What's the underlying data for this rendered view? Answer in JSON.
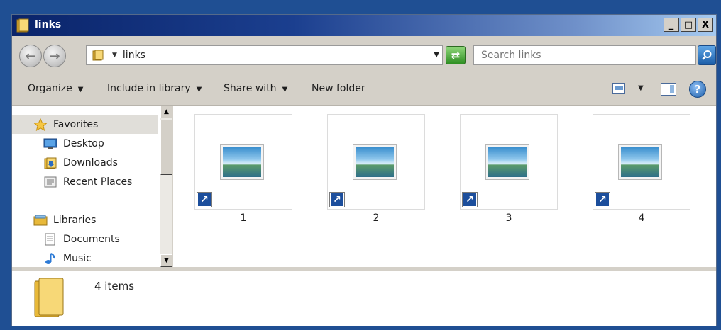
{
  "window": {
    "title": "links",
    "controls": {
      "minimize": "_",
      "maximize": "□",
      "close": "X"
    }
  },
  "address_bar": {
    "path": "links",
    "search_placeholder": "Search links"
  },
  "command_bar": {
    "organize": "Organize",
    "include_in_library": "Include in library",
    "share_with": "Share with",
    "new_folder": "New folder"
  },
  "nav_pane": {
    "favorites": {
      "label": "Favorites",
      "items": [
        {
          "label": "Desktop",
          "icon": "desktop-icon"
        },
        {
          "label": "Downloads",
          "icon": "downloads-icon"
        },
        {
          "label": "Recent Places",
          "icon": "recent-places-icon"
        }
      ]
    },
    "libraries": {
      "label": "Libraries",
      "items": [
        {
          "label": "Documents",
          "icon": "documents-icon"
        },
        {
          "label": "Music",
          "icon": "music-icon"
        }
      ]
    }
  },
  "files": [
    {
      "name": "1",
      "type": "image-shortcut"
    },
    {
      "name": "2",
      "type": "image-shortcut"
    },
    {
      "name": "3",
      "type": "image-shortcut"
    },
    {
      "name": "4",
      "type": "image-shortcut"
    }
  ],
  "details_pane": {
    "item_count": "4 items"
  },
  "colors": {
    "titlebar_start": "#0a246a",
    "titlebar_end": "#a6caf0",
    "chrome": "#d4d0c8",
    "desktop_border": "#1f4f93"
  }
}
